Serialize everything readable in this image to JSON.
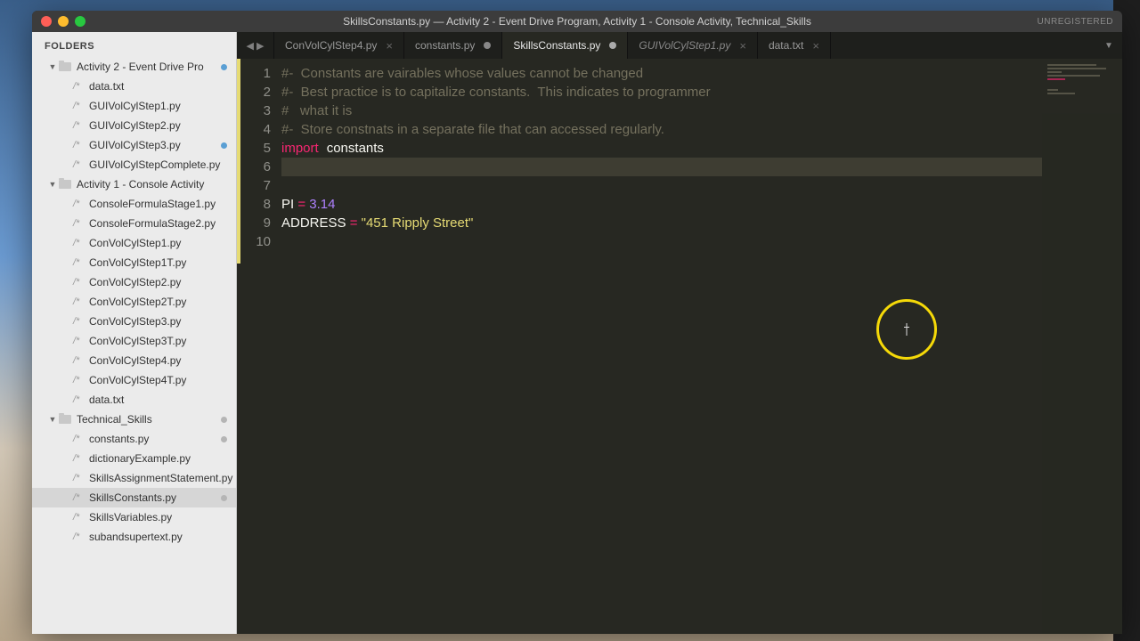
{
  "titlebar": {
    "title": "SkillsConstants.py — Activity 2 - Event Drive Program, Activity 1 - Console Activity, Technical_Skills",
    "unregistered": "UNREGISTERED"
  },
  "sidebar": {
    "header": "FOLDERS",
    "folders": [
      {
        "name": "Activity 2 - Event Drive Pro",
        "dot": "blue",
        "files": [
          {
            "name": "data.txt"
          },
          {
            "name": "GUIVolCylStep1.py"
          },
          {
            "name": "GUIVolCylStep2.py"
          },
          {
            "name": "GUIVolCylStep3.py",
            "dot": "blue"
          },
          {
            "name": "GUIVolCylStepComplete.py"
          }
        ]
      },
      {
        "name": "Activity 1 - Console Activity",
        "files": [
          {
            "name": "ConsoleFormulaStage1.py"
          },
          {
            "name": "ConsoleFormulaStage2.py"
          },
          {
            "name": "ConVolCylStep1.py"
          },
          {
            "name": "ConVolCylStep1T.py"
          },
          {
            "name": "ConVolCylStep2.py"
          },
          {
            "name": "ConVolCylStep2T.py"
          },
          {
            "name": "ConVolCylStep3.py"
          },
          {
            "name": "ConVolCylStep3T.py"
          },
          {
            "name": "ConVolCylStep4.py"
          },
          {
            "name": "ConVolCylStep4T.py"
          },
          {
            "name": "data.txt"
          }
        ]
      },
      {
        "name": "Technical_Skills",
        "dot": "gray",
        "files": [
          {
            "name": "constants.py",
            "dot": "gray"
          },
          {
            "name": "dictionaryExample.py"
          },
          {
            "name": "SkillsAssignmentStatement.py"
          },
          {
            "name": "SkillsConstants.py",
            "dot": "gray",
            "selected": true
          },
          {
            "name": "SkillsVariables.py"
          },
          {
            "name": "subandsupertext.py"
          }
        ]
      }
    ]
  },
  "tabs": {
    "items": [
      {
        "label": "ConVolCylStep4.py",
        "close": true
      },
      {
        "label": "constants.py",
        "dirty": true
      },
      {
        "label": "SkillsConstants.py",
        "dirty": true,
        "active": true
      },
      {
        "label": "GUIVolCylStep1.py",
        "close": true
      },
      {
        "label": "data.txt",
        "close": true
      }
    ]
  },
  "code": {
    "line1_comment": "#-  Constants are vairables whose values cannot be changed",
    "line2_comment": "#-  Best practice is to capitalize constants.  This indicates to programmer",
    "line3_comment": "#   what it is",
    "line4_comment": "#-  Store constnats in a separate file that can accessed regularly.",
    "import_kw": "import",
    "import_mod": "constants",
    "pi_name": "PI",
    "pi_eq": " = ",
    "pi_val": "3.14",
    "addr_name": "ADDRESS",
    "addr_eq": " = ",
    "addr_val": "\"451 Ripply Street\""
  },
  "gutter": [
    "1",
    "2",
    "3",
    "4",
    "5",
    "6",
    "7",
    "8",
    "9",
    "10"
  ]
}
